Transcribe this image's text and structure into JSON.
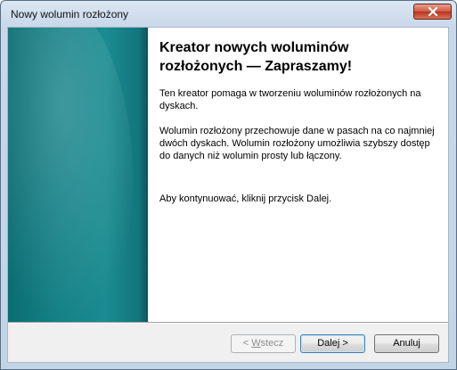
{
  "window": {
    "title": "Nowy wolumin rozłożony",
    "close_icon": "close-icon"
  },
  "wizard": {
    "heading": "Kreator nowych woluminów rozłożonych — Zapraszamy!",
    "paragraph1": "Ten kreator pomaga w tworzeniu woluminów rozłożonych na dyskach.",
    "paragraph2": "Wolumin rozłożony przechowuje dane w pasach na co najmniej dwóch dyskach. Wolumin rozłożony umożliwia szybszy dostęp do danych niż wolumin prosty lub łączony.",
    "paragraph3": "Aby kontynuować, kliknij przycisk Dalej."
  },
  "buttons": {
    "back_prefix": "< ",
    "back_accel": "W",
    "back_rest": "stecz",
    "next_label": "Dalej >",
    "cancel_label": "Anuluj"
  },
  "colors": {
    "banner": "#138086",
    "close_button": "#cd5a41"
  }
}
